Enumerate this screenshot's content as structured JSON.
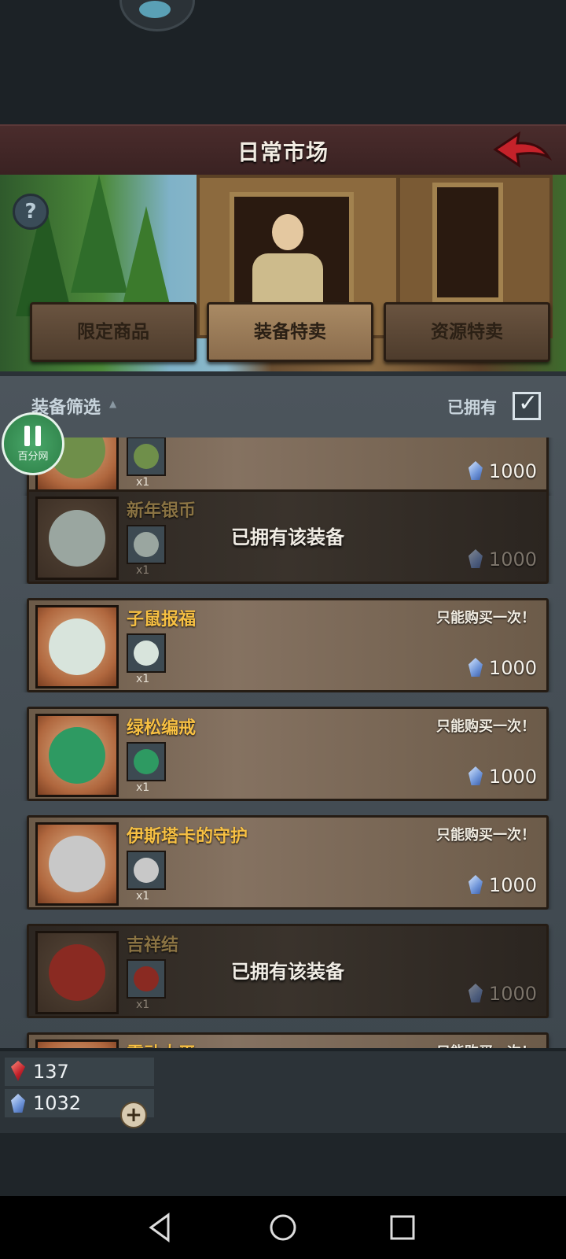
{
  "header": {
    "title": "日常市场",
    "back_icon": "back-arrow-icon"
  },
  "tabs": [
    {
      "label": "限定商品",
      "active": false
    },
    {
      "label": "装备特卖",
      "active": true
    },
    {
      "label": "资源特卖",
      "active": false
    }
  ],
  "filter": {
    "label": "装备筛选",
    "owned_label": "已拥有",
    "owned_checked": true
  },
  "overlay": {
    "pause_sub": "百分网"
  },
  "items": [
    {
      "name": "",
      "qty": "x1",
      "price": "1000",
      "limit": "",
      "owned": false,
      "owned_text": "",
      "icon": "flower-wreath-icon",
      "color": "#6f8f4a"
    },
    {
      "name": "新年银币",
      "qty": "x1",
      "price": "1000",
      "limit": "",
      "owned": true,
      "owned_text": "已拥有该装备",
      "icon": "silver-coin-icon",
      "color": "#9aa6a0"
    },
    {
      "name": "子鼠报福",
      "qty": "x1",
      "price": "1000",
      "limit": "只能购买一次！",
      "owned": false,
      "owned_text": "",
      "icon": "jade-rat-icon",
      "color": "#d8e4dc"
    },
    {
      "name": "绿松编戒",
      "qty": "x1",
      "price": "1000",
      "limit": "只能购买一次！",
      "owned": false,
      "owned_text": "",
      "icon": "turquoise-ring-icon",
      "color": "#2e9a62"
    },
    {
      "name": "伊斯塔卡的守护",
      "qty": "x1",
      "price": "1000",
      "limit": "只能购买一次！",
      "owned": false,
      "owned_text": "",
      "icon": "silver-charm-icon",
      "color": "#c8c8c8"
    },
    {
      "name": "吉祥结",
      "qty": "x1",
      "price": "1000",
      "limit": "",
      "owned": true,
      "owned_text": "已拥有该装备",
      "icon": "lucky-knot-icon",
      "color": "#8a2a22"
    },
    {
      "name": "雷动大平",
      "qty": "",
      "price": "",
      "limit": "只能购买一次！",
      "owned": false,
      "owned_text": "",
      "icon": "partial-item-icon",
      "color": "#7a7a7a"
    }
  ],
  "currency": {
    "rubies": "137",
    "gems": "1032"
  },
  "colors": {
    "gold_text": "#f7c043",
    "header_bg": "#4a2c2c",
    "list_bg": "#4c555c"
  }
}
